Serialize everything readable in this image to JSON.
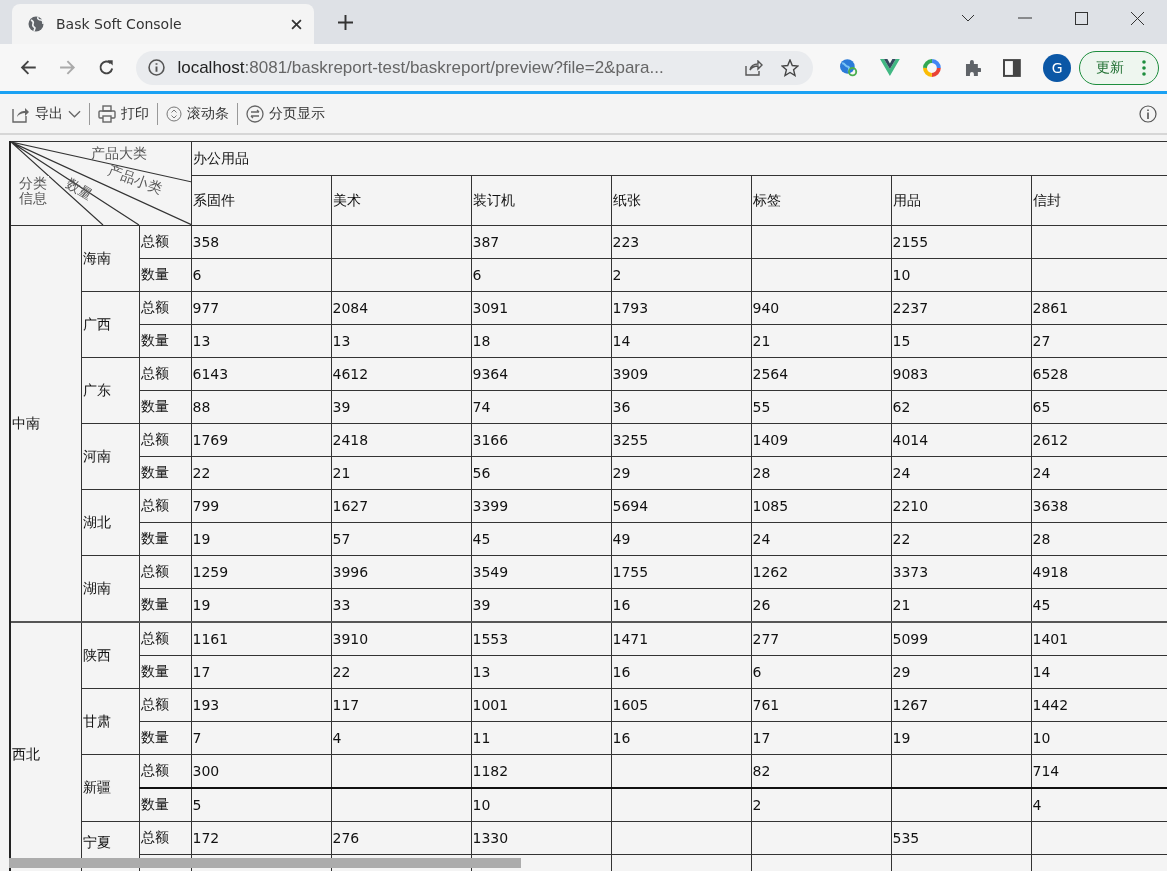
{
  "browser": {
    "tab_title": "Bask Soft Console",
    "url_host": "localhost",
    "url_rest": ":8081/baskreport-test/baskreport/preview?file=2&para...",
    "profile_initial": "G",
    "update_button": "更新"
  },
  "toolbar": [
    {
      "label": "导出",
      "kind": "export"
    },
    {
      "label": "打印",
      "kind": "print"
    },
    {
      "label": "滚动条",
      "kind": "scroll"
    },
    {
      "label": "分页显示",
      "kind": "paging"
    }
  ],
  "report": {
    "corner": {
      "top": "产品大类",
      "middle": "产品小类",
      "lower": "数量",
      "left": "分类信息"
    },
    "category": "办公用品",
    "subcategories": [
      "系固件",
      "美术",
      "装订机",
      "纸张",
      "标签",
      "用品",
      "信封"
    ],
    "regions": [
      {
        "name": "中南",
        "provinces": [
          {
            "name": "海南",
            "rows": [
              {
                "metric": "总额",
                "cells": [
                  {
                    "value": "358"
                  },
                  {
                    "blank": true
                  },
                  {
                    "value": "387"
                  },
                  {
                    "value": "223"
                  },
                  {
                    "blank": true
                  },
                  {
                    "value": "2155"
                  },
                  {
                    "blank": true
                  }
                ]
              },
              {
                "metric": "数量",
                "cells": [
                  {
                    "value": "6"
                  },
                  {
                    "blank": true
                  },
                  {
                    "value": "6"
                  },
                  {
                    "value": "2"
                  },
                  {
                    "blank": true
                  },
                  {
                    "value": "10"
                  },
                  {
                    "blank": true
                  }
                ]
              }
            ]
          },
          {
            "name": "广西",
            "rows": [
              {
                "metric": "总额",
                "cells": [
                  {
                    "value": "977"
                  },
                  {
                    "value": "2084"
                  },
                  {
                    "value": "3091"
                  },
                  {
                    "value": "1793"
                  },
                  {
                    "value": "940"
                  },
                  {
                    "value": "2237"
                  },
                  {
                    "value": "2861"
                  }
                ]
              },
              {
                "metric": "数量",
                "cells": [
                  {
                    "value": "13"
                  },
                  {
                    "value": "13"
                  },
                  {
                    "value": "18"
                  },
                  {
                    "value": "14"
                  },
                  {
                    "value": "21"
                  },
                  {
                    "value": "15"
                  },
                  {
                    "value": "27"
                  }
                ]
              }
            ]
          },
          {
            "name": "广东",
            "rows": [
              {
                "metric": "总额",
                "cells": [
                  {
                    "value": "6143"
                  },
                  {
                    "value": "4612"
                  },
                  {
                    "value": "9364"
                  },
                  {
                    "value": "3909"
                  },
                  {
                    "value": "2564"
                  },
                  {
                    "value": "9083"
                  },
                  {
                    "value": "6528"
                  }
                ]
              },
              {
                "metric": "数量",
                "cells": [
                  {
                    "value": "88"
                  },
                  {
                    "value": "39"
                  },
                  {
                    "value": "74"
                  },
                  {
                    "value": "36"
                  },
                  {
                    "value": "55"
                  },
                  {
                    "value": "62"
                  },
                  {
                    "value": "65"
                  }
                ]
              }
            ]
          },
          {
            "name": "河南",
            "rows": [
              {
                "metric": "总额",
                "cells": [
                  {
                    "value": "1769"
                  },
                  {
                    "value": "2418"
                  },
                  {
                    "value": "3166"
                  },
                  {
                    "value": "3255"
                  },
                  {
                    "value": "1409"
                  },
                  {
                    "value": "4014"
                  },
                  {
                    "value": "2612"
                  }
                ]
              },
              {
                "metric": "数量",
                "cells": [
                  {
                    "value": "22"
                  },
                  {
                    "value": "21"
                  },
                  {
                    "value": "56"
                  },
                  {
                    "value": "29"
                  },
                  {
                    "value": "28"
                  },
                  {
                    "value": "24"
                  },
                  {
                    "value": "24"
                  }
                ]
              }
            ]
          },
          {
            "name": "湖北",
            "rows": [
              {
                "metric": "总额",
                "cells": [
                  {
                    "value": "799"
                  },
                  {
                    "value": "1627"
                  },
                  {
                    "value": "3399"
                  },
                  {
                    "value": "5694"
                  },
                  {
                    "value": "1085"
                  },
                  {
                    "value": "2210"
                  },
                  {
                    "value": "3638"
                  }
                ]
              },
              {
                "metric": "数量",
                "cells": [
                  {
                    "value": "19"
                  },
                  {
                    "value": "57"
                  },
                  {
                    "value": "45"
                  },
                  {
                    "value": "49"
                  },
                  {
                    "value": "24"
                  },
                  {
                    "value": "22"
                  },
                  {
                    "value": "28"
                  }
                ]
              }
            ]
          },
          {
            "name": "湖南",
            "rows": [
              {
                "metric": "总额",
                "cells": [
                  {
                    "value": "1259"
                  },
                  {
                    "value": "3996"
                  },
                  {
                    "value": "3549"
                  },
                  {
                    "value": "1755"
                  },
                  {
                    "value": "1262"
                  },
                  {
                    "value": "3373"
                  },
                  {
                    "value": "4918"
                  }
                ]
              },
              {
                "metric": "数量",
                "cells": [
                  {
                    "value": "19"
                  },
                  {
                    "value": "33"
                  },
                  {
                    "value": "39"
                  },
                  {
                    "value": "16"
                  },
                  {
                    "value": "26"
                  },
                  {
                    "value": "21"
                  },
                  {
                    "value": "45"
                  }
                ]
              }
            ]
          }
        ]
      },
      {
        "name": "西北",
        "provinces": [
          {
            "name": "陕西",
            "rows": [
              {
                "metric": "总额",
                "cells": [
                  {
                    "value": "1161"
                  },
                  {
                    "value": "3910"
                  },
                  {
                    "value": "1553"
                  },
                  {
                    "value": "1471"
                  },
                  {
                    "value": "277"
                  },
                  {
                    "value": "5099"
                  },
                  {
                    "value": "1401"
                  }
                ]
              },
              {
                "metric": "数量",
                "cells": [
                  {
                    "value": "17"
                  },
                  {
                    "value": "22"
                  },
                  {
                    "value": "13"
                  },
                  {
                    "value": "16"
                  },
                  {
                    "value": "6"
                  },
                  {
                    "value": "29"
                  },
                  {
                    "value": "14"
                  }
                ]
              }
            ]
          },
          {
            "name": "甘肃",
            "rows": [
              {
                "metric": "总额",
                "cells": [
                  {
                    "value": "193"
                  },
                  {
                    "value": "117"
                  },
                  {
                    "value": "1001"
                  },
                  {
                    "value": "1605"
                  },
                  {
                    "value": "761"
                  },
                  {
                    "value": "1267"
                  },
                  {
                    "value": "1442"
                  }
                ]
              },
              {
                "metric": "数量",
                "cells": [
                  {
                    "value": "7"
                  },
                  {
                    "value": "4"
                  },
                  {
                    "value": "11"
                  },
                  {
                    "value": "16"
                  },
                  {
                    "value": "17"
                  },
                  {
                    "value": "19"
                  },
                  {
                    "value": "10"
                  }
                ]
              }
            ]
          },
          {
            "name": "新疆",
            "rows": [
              {
                "metric": "总额",
                "cells": [
                  {
                    "value": "300"
                  },
                  {
                    "blank": true
                  },
                  {
                    "value": "1182"
                  },
                  {
                    "blank": true
                  },
                  {
                    "value": "82"
                  },
                  {
                    "blank": true
                  },
                  {
                    "value": "714"
                  }
                ]
              },
              {
                "metric": "数量",
                "cells": [
                  {
                    "value": "5"
                  },
                  {
                    "blank": true
                  },
                  {
                    "value": "10"
                  },
                  {
                    "blank": true
                  },
                  {
                    "value": "2"
                  },
                  {
                    "blank": true
                  },
                  {
                    "value": "4"
                  }
                ]
              }
            ]
          },
          {
            "name": "宁夏",
            "rows": [
              {
                "metric": "总额",
                "cells": [
                  {
                    "value": "172"
                  },
                  {
                    "value": "276"
                  },
                  {
                    "value": "1330"
                  },
                  {
                    "blank": true
                  },
                  {
                    "blank": true
                  },
                  {
                    "value": "535"
                  },
                  {
                    "blank": true
                  }
                ]
              }
            ]
          }
        ]
      }
    ]
  }
}
